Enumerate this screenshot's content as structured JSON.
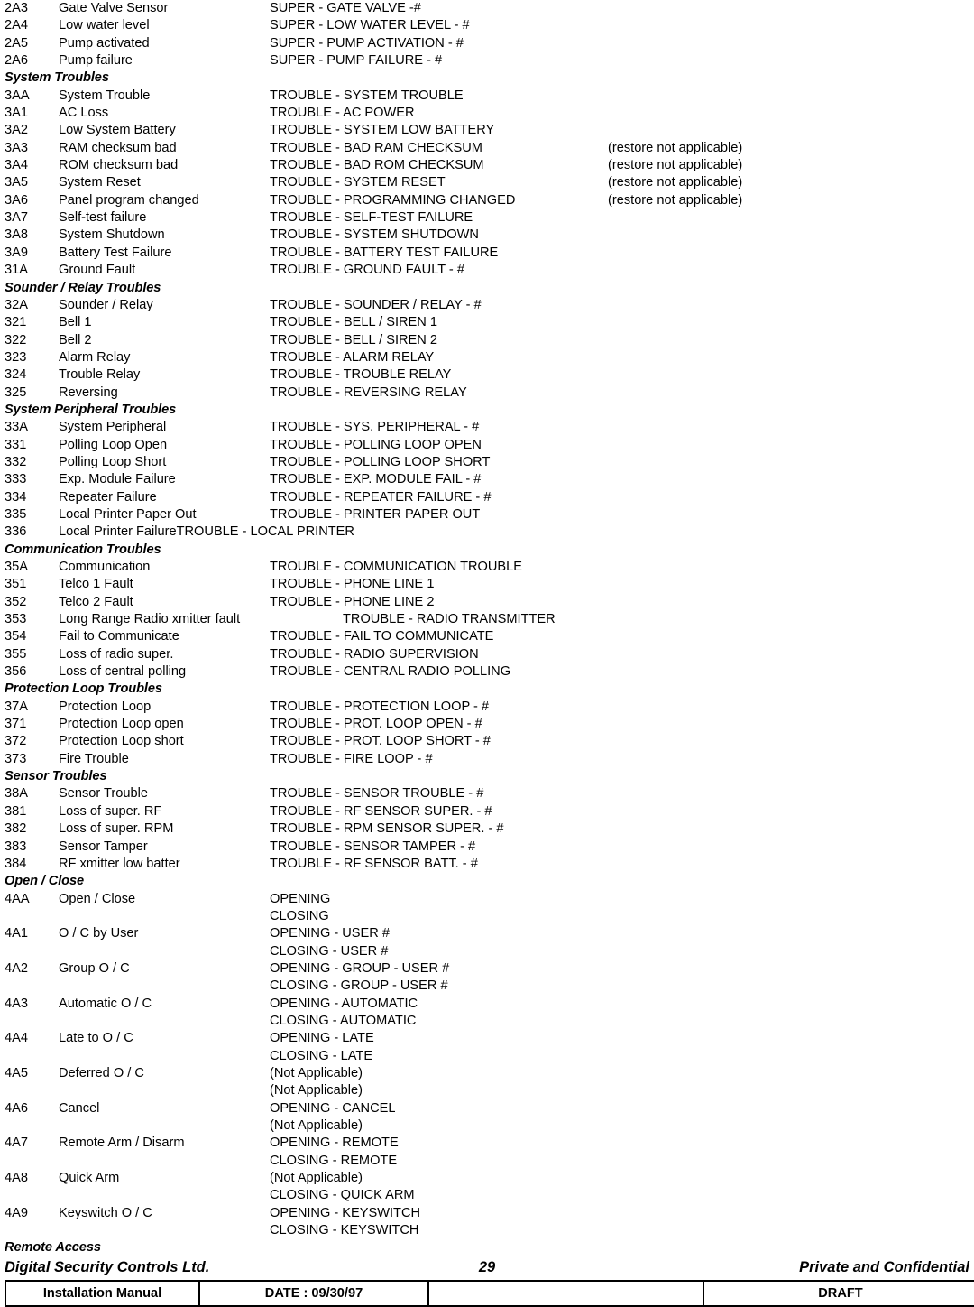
{
  "document": {
    "rows": [
      {
        "type": "entry",
        "code": "2A3",
        "desc": "Gate Valve Sensor",
        "msg": "SUPER - GATE VALVE -#",
        "note": ""
      },
      {
        "type": "entry",
        "code": "2A4",
        "desc": "Low water level",
        "msg": "SUPER - LOW WATER LEVEL - #",
        "note": ""
      },
      {
        "type": "entry",
        "code": "2A5",
        "desc": "Pump activated",
        "msg": "SUPER - PUMP ACTIVATION - #",
        "note": ""
      },
      {
        "type": "entry",
        "code": "2A6",
        "desc": "Pump failure",
        "msg": "SUPER - PUMP FAILURE - #",
        "note": ""
      },
      {
        "type": "heading",
        "heading": "System Troubles"
      },
      {
        "type": "entry",
        "code": "3AA",
        "desc": "System Trouble",
        "msg": "TROUBLE - SYSTEM TROUBLE",
        "note": ""
      },
      {
        "type": "entry",
        "code": "3A1",
        "desc": "AC Loss",
        "msg": "TROUBLE - AC POWER",
        "note": ""
      },
      {
        "type": "entry",
        "code": "3A2",
        "desc": "Low System Battery",
        "msg": "TROUBLE - SYSTEM LOW BATTERY",
        "note": ""
      },
      {
        "type": "entry",
        "code": "3A3",
        "desc": "RAM checksum bad",
        "msg": "TROUBLE - BAD RAM CHECKSUM",
        "note": "(restore not applicable)"
      },
      {
        "type": "entry",
        "code": "3A4",
        "desc": "ROM checksum bad",
        "msg": "TROUBLE - BAD ROM CHECKSUM",
        "note": "(restore not applicable)"
      },
      {
        "type": "entry",
        "code": "3A5",
        "desc": "System Reset",
        "msg": "TROUBLE - SYSTEM RESET",
        "note": "(restore not applicable)"
      },
      {
        "type": "entry",
        "code": "3A6",
        "desc": "Panel program changed",
        "msg": "TROUBLE - PROGRAMMING CHANGED",
        "note": "(restore not applicable)"
      },
      {
        "type": "entry",
        "code": "3A7",
        "desc": "Self-test failure",
        "msg": "TROUBLE - SELF-TEST FAILURE",
        "note": ""
      },
      {
        "type": "entry",
        "code": "3A8",
        "desc": "System Shutdown",
        "msg": "TROUBLE - SYSTEM SHUTDOWN",
        "note": ""
      },
      {
        "type": "entry",
        "code": "3A9",
        "desc": "Battery Test Failure",
        "msg": "TROUBLE - BATTERY TEST FAILURE",
        "note": ""
      },
      {
        "type": "entry",
        "code": "31A",
        "desc": "Ground Fault",
        "msg": "TROUBLE - GROUND FAULT - #",
        "note": ""
      },
      {
        "type": "heading",
        "heading": "Sounder / Relay Troubles"
      },
      {
        "type": "entry",
        "code": "32A",
        "desc": "Sounder / Relay",
        "msg": "TROUBLE - SOUNDER / RELAY - #",
        "note": ""
      },
      {
        "type": "entry",
        "code": "321",
        "desc": "Bell 1",
        "msg": "TROUBLE - BELL / SIREN 1",
        "note": ""
      },
      {
        "type": "entry",
        "code": "322",
        "desc": "Bell 2",
        "msg": "TROUBLE - BELL / SIREN 2",
        "note": ""
      },
      {
        "type": "entry",
        "code": "323",
        "desc": "Alarm Relay",
        "msg": "TROUBLE - ALARM RELAY",
        "note": ""
      },
      {
        "type": "entry",
        "code": "324",
        "desc": "Trouble Relay",
        "msg": "TROUBLE - TROUBLE RELAY",
        "note": ""
      },
      {
        "type": "entry",
        "code": "325",
        "desc": "Reversing",
        "msg": "TROUBLE - REVERSING RELAY",
        "note": ""
      },
      {
        "type": "heading",
        "heading": "System Peripheral Troubles"
      },
      {
        "type": "entry",
        "code": "33A",
        "desc": "System Peripheral",
        "msg": "TROUBLE - SYS. PERIPHERAL - #",
        "note": ""
      },
      {
        "type": "entry",
        "code": "331",
        "desc": "Polling Loop Open",
        "msg": "TROUBLE - POLLING LOOP OPEN",
        "note": ""
      },
      {
        "type": "entry",
        "code": "332",
        "desc": "Polling Loop Short",
        "msg": "TROUBLE - POLLING LOOP SHORT",
        "note": ""
      },
      {
        "type": "entry",
        "code": "333",
        "desc": "Exp. Module Failure",
        "msg": "TROUBLE - EXP. MODULE FAIL - #",
        "note": ""
      },
      {
        "type": "entry",
        "code": "334",
        "desc": "Repeater Failure",
        "msg": "TROUBLE - REPEATER FAILURE - #",
        "note": ""
      },
      {
        "type": "entry",
        "code": "335",
        "desc": "Local Printer Paper Out",
        "msg": "TROUBLE - PRINTER PAPER OUT",
        "note": ""
      },
      {
        "type": "joined",
        "code": "336",
        "desc": "Local Printer Failure",
        "msg": "TROUBLE - LOCAL PRINTER",
        "note": ""
      },
      {
        "type": "heading",
        "heading": "Communication Troubles"
      },
      {
        "type": "entry",
        "code": "35A",
        "desc": "Communication",
        "msg": "TROUBLE - COMMUNICATION TROUBLE",
        "note": ""
      },
      {
        "type": "entry",
        "code": "351",
        "desc": "Telco 1 Fault",
        "msg": "TROUBLE - PHONE LINE 1",
        "note": ""
      },
      {
        "type": "entry",
        "code": "352",
        "desc": "Telco 2 Fault",
        "msg": "TROUBLE - PHONE LINE 2",
        "note": ""
      },
      {
        "type": "tabbed",
        "code": "353",
        "desc": "Long Range Radio xmitter fault",
        "msg": "TROUBLE - RADIO TRANSMITTER",
        "note": ""
      },
      {
        "type": "entry",
        "code": "354",
        "desc": "Fail to Communicate",
        "msg": "TROUBLE - FAIL TO COMMUNICATE",
        "note": ""
      },
      {
        "type": "entry",
        "code": "355",
        "desc": "Loss of radio super.",
        "msg": "TROUBLE - RADIO SUPERVISION",
        "note": ""
      },
      {
        "type": "entry",
        "code": "356",
        "desc": "Loss of central polling",
        "msg": "TROUBLE - CENTRAL RADIO POLLING",
        "note": ""
      },
      {
        "type": "heading",
        "heading": "Protection Loop Troubles"
      },
      {
        "type": "entry",
        "code": "37A",
        "desc": "Protection Loop",
        "msg": "TROUBLE - PROTECTION LOOP - #",
        "note": ""
      },
      {
        "type": "entry",
        "code": "371",
        "desc": "Protection Loop open",
        "msg": "TROUBLE - PROT. LOOP OPEN - #",
        "note": ""
      },
      {
        "type": "entry",
        "code": "372",
        "desc": "Protection Loop short",
        "msg": "TROUBLE - PROT. LOOP SHORT - #",
        "note": ""
      },
      {
        "type": "entry",
        "code": "373",
        "desc": "Fire Trouble",
        "msg": "TROUBLE - FIRE LOOP - #",
        "note": ""
      },
      {
        "type": "heading",
        "heading": "Sensor Troubles"
      },
      {
        "type": "entry",
        "code": "38A",
        "desc": "Sensor Trouble",
        "msg": "TROUBLE - SENSOR TROUBLE - #",
        "note": ""
      },
      {
        "type": "entry",
        "code": "381",
        "desc": "Loss of super. RF",
        "msg": "TROUBLE - RF SENSOR SUPER. - #",
        "note": ""
      },
      {
        "type": "entry",
        "code": "382",
        "desc": "Loss of super. RPM",
        "msg": "TROUBLE - RPM SENSOR SUPER. - #",
        "note": ""
      },
      {
        "type": "entry",
        "code": "383",
        "desc": "Sensor Tamper",
        "msg": "TROUBLE - SENSOR TAMPER - #",
        "note": ""
      },
      {
        "type": "entry",
        "code": "384",
        "desc": "RF xmitter low batter",
        "msg": "TROUBLE - RF SENSOR BATT. - #",
        "note": ""
      },
      {
        "type": "heading",
        "heading": "Open / Close"
      },
      {
        "type": "entry",
        "code": "4AA",
        "desc": "Open / Close",
        "msg": "OPENING",
        "note": ""
      },
      {
        "type": "contline",
        "code": "",
        "desc": "",
        "msg": "CLOSING",
        "note": ""
      },
      {
        "type": "entry",
        "code": "4A1",
        "desc": "O / C by User",
        "msg": "OPENING - USER #",
        "note": ""
      },
      {
        "type": "contline",
        "code": "",
        "desc": "",
        "msg": "CLOSING - USER #",
        "note": ""
      },
      {
        "type": "entry",
        "code": "4A2",
        "desc": "Group O / C",
        "msg": "OPENING - GROUP - USER #",
        "note": ""
      },
      {
        "type": "contline",
        "code": "",
        "desc": "",
        "msg": "CLOSING - GROUP - USER #",
        "note": ""
      },
      {
        "type": "entry",
        "code": "4A3",
        "desc": "Automatic O / C",
        "msg": "OPENING - AUTOMATIC",
        "note": ""
      },
      {
        "type": "contline",
        "code": "",
        "desc": "",
        "msg": "CLOSING - AUTOMATIC",
        "note": ""
      },
      {
        "type": "entry",
        "code": "4A4",
        "desc": "Late to O / C",
        "msg": "OPENING - LATE",
        "note": ""
      },
      {
        "type": "contline",
        "code": "",
        "desc": "",
        "msg": "CLOSING - LATE",
        "note": ""
      },
      {
        "type": "entry",
        "code": "4A5",
        "desc": "Deferred O / C",
        "msg": "(Not Applicable)",
        "note": ""
      },
      {
        "type": "contline",
        "code": "",
        "desc": "",
        "msg": "(Not Applicable)",
        "note": ""
      },
      {
        "type": "entry",
        "code": "4A6",
        "desc": "Cancel",
        "msg": "OPENING - CANCEL",
        "note": ""
      },
      {
        "type": "contline",
        "code": "",
        "desc": "",
        "msg": "(Not Applicable)",
        "note": ""
      },
      {
        "type": "entry",
        "code": "4A7",
        "desc": "Remote Arm / Disarm",
        "msg": "OPENING - REMOTE",
        "note": ""
      },
      {
        "type": "contline",
        "code": "",
        "desc": "",
        "msg": "CLOSING - REMOTE",
        "note": ""
      },
      {
        "type": "entry",
        "code": "4A8",
        "desc": "Quick Arm",
        "msg": "(Not Applicable)",
        "note": ""
      },
      {
        "type": "contline",
        "code": "",
        "desc": "",
        "msg": "CLOSING - QUICK ARM",
        "note": ""
      },
      {
        "type": "entry",
        "code": "4A9",
        "desc": "Keyswitch O / C",
        "msg": "OPENING - KEYSWITCH",
        "note": ""
      },
      {
        "type": "contline",
        "code": "",
        "desc": "",
        "msg": "CLOSING - KEYSWITCH",
        "note": ""
      },
      {
        "type": "heading",
        "heading": "Remote Access"
      }
    ]
  },
  "footer": {
    "company": "Digital Security Controls Ltd.",
    "page_number": "29",
    "confidentiality": "Private and Confidential",
    "manual_label": "Installation Manual",
    "date_label": "DATE :  09/30/97",
    "blank_cell": "",
    "status_label": "DRAFT"
  }
}
